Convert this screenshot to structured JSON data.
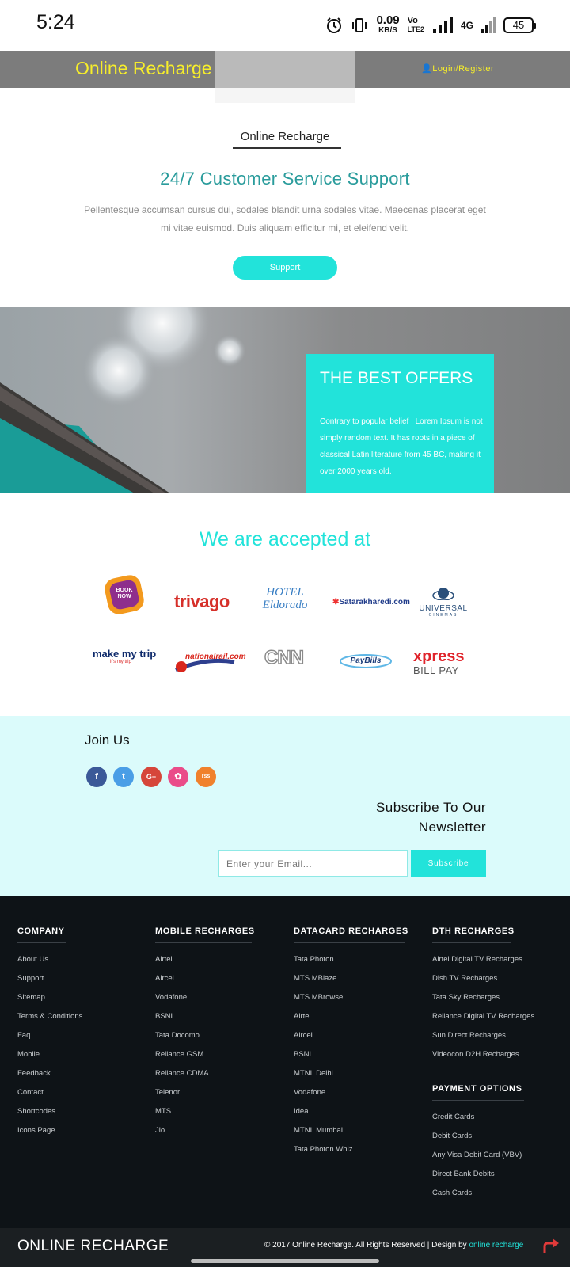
{
  "status": {
    "time": "5:24",
    "speed_value": "0.09",
    "speed_unit": "KB/S",
    "volte_top": "Vo",
    "volte_bottom": "LTE2",
    "net": "4G",
    "battery": "45"
  },
  "header": {
    "brand": "Online Recharge",
    "login": "Login/Register"
  },
  "intro": {
    "section_label": "Online Recharge",
    "headline": "24/7 Customer Service Support",
    "text": "Pellentesque accumsan cursus dui, sodales blandit urna sodales vitae. Maecenas placerat eget mi vitae euismod. Duis aliquam efficitur mi, et eleifend velit.",
    "button": "Support"
  },
  "offer": {
    "title": "THE BEST OFFERS",
    "text": "Contrary to popular belief , Lorem Ipsum is not simply random text. It has roots in a piece of classical Latin literature from 45 BC, making it over 2000 years old."
  },
  "accepted": {
    "title": "We are accepted at",
    "logos": [
      "BOOK NOW",
      "trivago",
      "HOTEL Eldorado",
      "Satarakharedi.com",
      "UNIVERSAL",
      "make my trip",
      "nationalrail.com",
      "CNN",
      "PayBills",
      "xpress BILL PAY"
    ],
    "makemytrip_tag": "it's my trip",
    "universal_sub": "CINEMAS"
  },
  "join": {
    "title": "Join Us",
    "social": [
      "f",
      "t",
      "G+",
      "✿",
      "rss"
    ],
    "subscribe_title": "Subscribe To Our Newsletter",
    "email_placeholder": "Enter your Email...",
    "subscribe_button": "Subscribe"
  },
  "footer": {
    "company": {
      "title": "COMPANY",
      "links": [
        "About Us",
        "Support",
        "Sitemap",
        "Terms & Conditions",
        "Faq",
        "Mobile",
        "Feedback",
        "Contact",
        "Shortcodes",
        "Icons Page"
      ]
    },
    "mobile": {
      "title": "MOBILE RECHARGES",
      "links": [
        "Airtel",
        "Aircel",
        "Vodafone",
        "BSNL",
        "Tata Docomo",
        "Reliance GSM",
        "Reliance CDMA",
        "Telenor",
        "MTS",
        "Jio"
      ]
    },
    "datacard": {
      "title": "DATACARD RECHARGES",
      "links": [
        "Tata Photon",
        "MTS MBlaze",
        "MTS MBrowse",
        "Airtel",
        "Aircel",
        "BSNL",
        "MTNL Delhi",
        "Vodafone",
        "Idea",
        "MTNL Mumbai",
        "Tata Photon Whiz"
      ]
    },
    "dth": {
      "title": "DTH RECHARGES",
      "links": [
        "Airtel Digital TV Recharges",
        "Dish TV Recharges",
        "Tata Sky Recharges",
        "Reliance Digital TV Recharges",
        "Sun Direct Recharges",
        "Videocon D2H Recharges"
      ]
    },
    "payment": {
      "title": "PAYMENT OPTIONS",
      "links": [
        "Credit Cards",
        "Debit Cards",
        "Any Visa Debit Card (VBV)",
        "Direct Bank Debits",
        "Cash Cards"
      ]
    }
  },
  "bottom": {
    "brand": "ONLINE RECHARGE",
    "copyright": "© 2017 Online Recharge. All Rights Reserved | Design by",
    "design_link": "online recharge"
  }
}
